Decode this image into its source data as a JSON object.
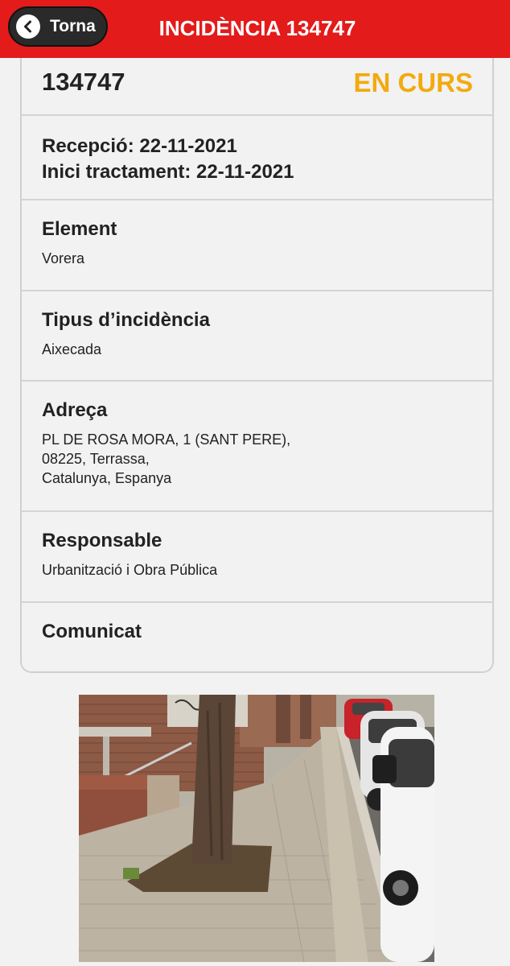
{
  "header": {
    "back_label": "Torna",
    "title": "INCIDÈNCIA 134747"
  },
  "incident": {
    "id": "134747",
    "status": "EN CURS",
    "reception": "Recepció: 22-11-2021",
    "treatment_start": "Inici tractament: 22-11-2021"
  },
  "fields": {
    "element": {
      "label": "Element",
      "value": "Vorera"
    },
    "type": {
      "label": "Tipus d’incidència",
      "value": "Aixecada"
    },
    "address": {
      "label": "Adreça",
      "line1": "PL DE ROSA MORA, 1 (SANT PERE),",
      "line2": "08225, Terrassa,",
      "line3": "Catalunya, Espanya"
    },
    "responsible": {
      "label": "Responsable",
      "value": "Urbanització i Obra Pública"
    },
    "communicated": {
      "label": "Comunicat"
    }
  },
  "colors": {
    "header": "#e31b1b",
    "status": "#f2aa0f"
  },
  "icons": {
    "back": "chevron-left-icon"
  }
}
